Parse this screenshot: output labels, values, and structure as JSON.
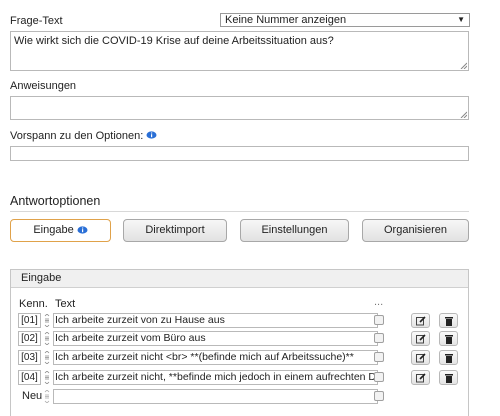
{
  "question": {
    "label": "Frage-Text",
    "numbering_select": "Keine Nummer anzeigen",
    "text": "Wie wirkt sich die COVID-19 Krise auf deine Arbeitssituation aus?"
  },
  "instructions": {
    "label": "Anweisungen",
    "value": ""
  },
  "options_preface": {
    "label": "Vorspann zu den Optionen:",
    "value": ""
  },
  "answer_options": {
    "title": "Antwortoptionen",
    "tabs": [
      {
        "label": "Eingabe",
        "active": true
      },
      {
        "label": "Direktimport",
        "active": false
      },
      {
        "label": "Einstellungen",
        "active": false
      },
      {
        "label": "Organisieren",
        "active": false
      }
    ]
  },
  "entry_panel": {
    "title": "Eingabe",
    "col_code": "Kenn.",
    "col_text": "Text",
    "col_extra": "...",
    "rows": [
      {
        "code": "[01]",
        "text": "Ich arbeite zurzeit von zu Hause aus"
      },
      {
        "code": "[02]",
        "text": "Ich arbeite zurzeit vom Büro aus"
      },
      {
        "code": "[03]",
        "text": "Ich arbeite zurzeit nicht <br> **(befinde mich auf Arbeitssuche)**"
      },
      {
        "code": "[04]",
        "text": "Ich arbeite zurzeit nicht, **befinde mich jedoch in einem aufrechten D"
      }
    ],
    "new_label": "Neu"
  },
  "colors": {
    "active_tab_border": "#e0a24a",
    "info_icon": "#2a6fd6"
  },
  "icons": [
    "info-icon",
    "drag-handle-icon",
    "edit-icon",
    "trash-icon",
    "chevron-down-icon"
  ]
}
